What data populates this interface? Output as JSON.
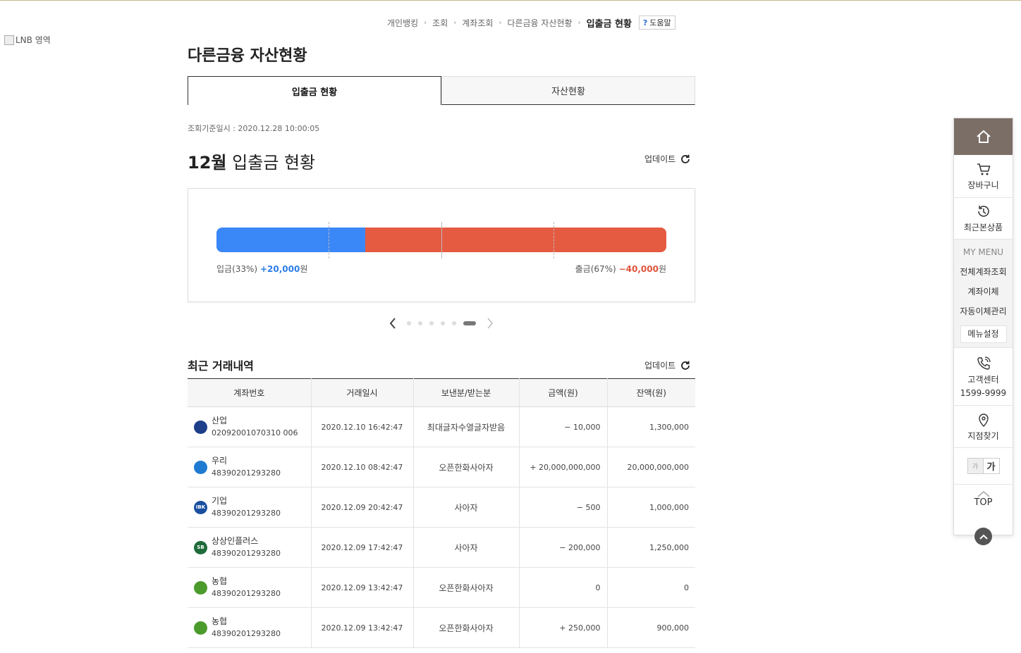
{
  "lnb": {
    "alt_text": "LNB 영역"
  },
  "breadcrumb": {
    "items": [
      "개인뱅킹",
      "조회",
      "계좌조회",
      "다른금융 자산현황"
    ],
    "current": "입출금 현황",
    "help_label": "도움말",
    "help_mark": "?"
  },
  "page": {
    "title": "다른금융 자산현황"
  },
  "tabs": [
    {
      "label": "입출금 현황",
      "active": true
    },
    {
      "label": "자산현황",
      "active": false
    }
  ],
  "query_time": "조회기준일시 : 2020.12.28 10:00:05",
  "summary": {
    "month": "12월",
    "title_rest": " 입출금 현황",
    "update_label": "업데이트",
    "deposit": {
      "label": "입금(33%)",
      "amount": "+20,000",
      "unit": "원",
      "ratio": 0.33,
      "color": "#3a87f7"
    },
    "withdraw": {
      "label": "출금(67%)",
      "amount": "−40,000",
      "unit": "원",
      "ratio": 0.67,
      "color": "#e55b42"
    }
  },
  "pager": {
    "total": 6,
    "active_index": 5
  },
  "recent": {
    "title": "최근 거래내역",
    "update_label": "업데이트",
    "columns": [
      "계좌번호",
      "거래일시",
      "보낸분/받는분",
      "금액(원)",
      "잔액(원)"
    ],
    "rows": [
      {
        "bank": "산업",
        "account": "02092001070310 006",
        "datetime": "2020.12.10 16:42:47",
        "party": "최대글자수열글자받음",
        "amount": "− 10,000",
        "sign": "minus",
        "balance": "1,300,000",
        "logo_color": "#1d3f8a",
        "logo_text": ""
      },
      {
        "bank": "우리",
        "account": "48390201293280",
        "datetime": "2020.12.10 08:42:47",
        "party": "오픈한화사아자",
        "amount": "+ 20,000,000,000",
        "sign": "plus",
        "balance": "20,000,000,000",
        "logo_color": "#1f7ad1",
        "logo_text": ""
      },
      {
        "bank": "기업",
        "account": "48390201293280",
        "datetime": "2020.12.09 20:42:47",
        "party": "사아자",
        "amount": "− 500",
        "sign": "minus",
        "balance": "1,000,000",
        "logo_color": "#1a4fa0",
        "logo_text": "IBK"
      },
      {
        "bank": "상상인플러스",
        "account": "48390201293280",
        "datetime": "2020.12.09 17:42:47",
        "party": "사아자",
        "amount": "− 200,000",
        "sign": "minus",
        "balance": "1,250,000",
        "logo_color": "#1e6b3a",
        "logo_text": "SB"
      },
      {
        "bank": "농협",
        "account": "48390201293280",
        "datetime": "2020.12.09 13:42:47",
        "party": "오픈한화사아자",
        "amount": "0",
        "sign": "none",
        "balance": "0",
        "logo_color": "#4b9b2c",
        "logo_text": ""
      },
      {
        "bank": "농협",
        "account": "48390201293280",
        "datetime": "2020.12.09 13:42:47",
        "party": "오픈한화사아자",
        "amount": "+ 250,000",
        "sign": "plus",
        "balance": "900,000",
        "logo_color": "#4b9b2c",
        "logo_text": ""
      }
    ]
  },
  "quick_menu": {
    "cart": "장바구니",
    "recent_products": "최근본상품",
    "my_menu": "MY MENU",
    "links": [
      "전체계좌조회",
      "계좌이체",
      "자동이체관리"
    ],
    "menu_setting": "메뉴설정",
    "call_center": "고객센터",
    "phone": "1599-9999",
    "branch": "지점찾기",
    "font_small": "가",
    "font_big": "가",
    "top": "TOP"
  }
}
